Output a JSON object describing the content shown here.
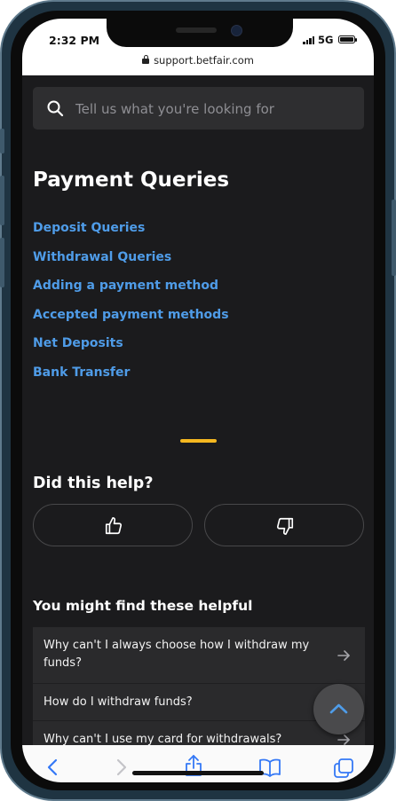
{
  "status_bar": {
    "time": "2:32 PM",
    "network": "5G",
    "url": "support.betfair.com"
  },
  "search": {
    "placeholder": "Tell us what you're looking for",
    "value": ""
  },
  "section": {
    "title": "Payment Queries",
    "links": [
      "Deposit Queries",
      "Withdrawal Queries",
      "Adding a payment method",
      "Accepted payment methods",
      "Net Deposits",
      "Bank Transfer"
    ]
  },
  "feedback": {
    "title": "Did this help?"
  },
  "helpful": {
    "title": "You might find these helpful",
    "items": [
      "Why can't I always choose how I withdraw my funds?",
      "How do I withdraw funds?",
      "Why can't I use my card for withdrawals?"
    ]
  },
  "colors": {
    "link": "#4f9ce8",
    "accent": "#f5b820",
    "background": "#1b1b1d",
    "toolbar_icon": "#3478f6"
  },
  "icons": {
    "search": "search-icon",
    "thumbs_up": "thumbs-up-icon",
    "thumbs_down": "thumbs-down-icon",
    "arrow": "arrow-right-icon",
    "scroll_top": "chevron-up-icon",
    "back": "back-chevron-icon",
    "forward": "forward-chevron-icon",
    "share": "share-icon",
    "bookmarks": "bookmarks-icon",
    "tabs": "tabs-icon"
  }
}
